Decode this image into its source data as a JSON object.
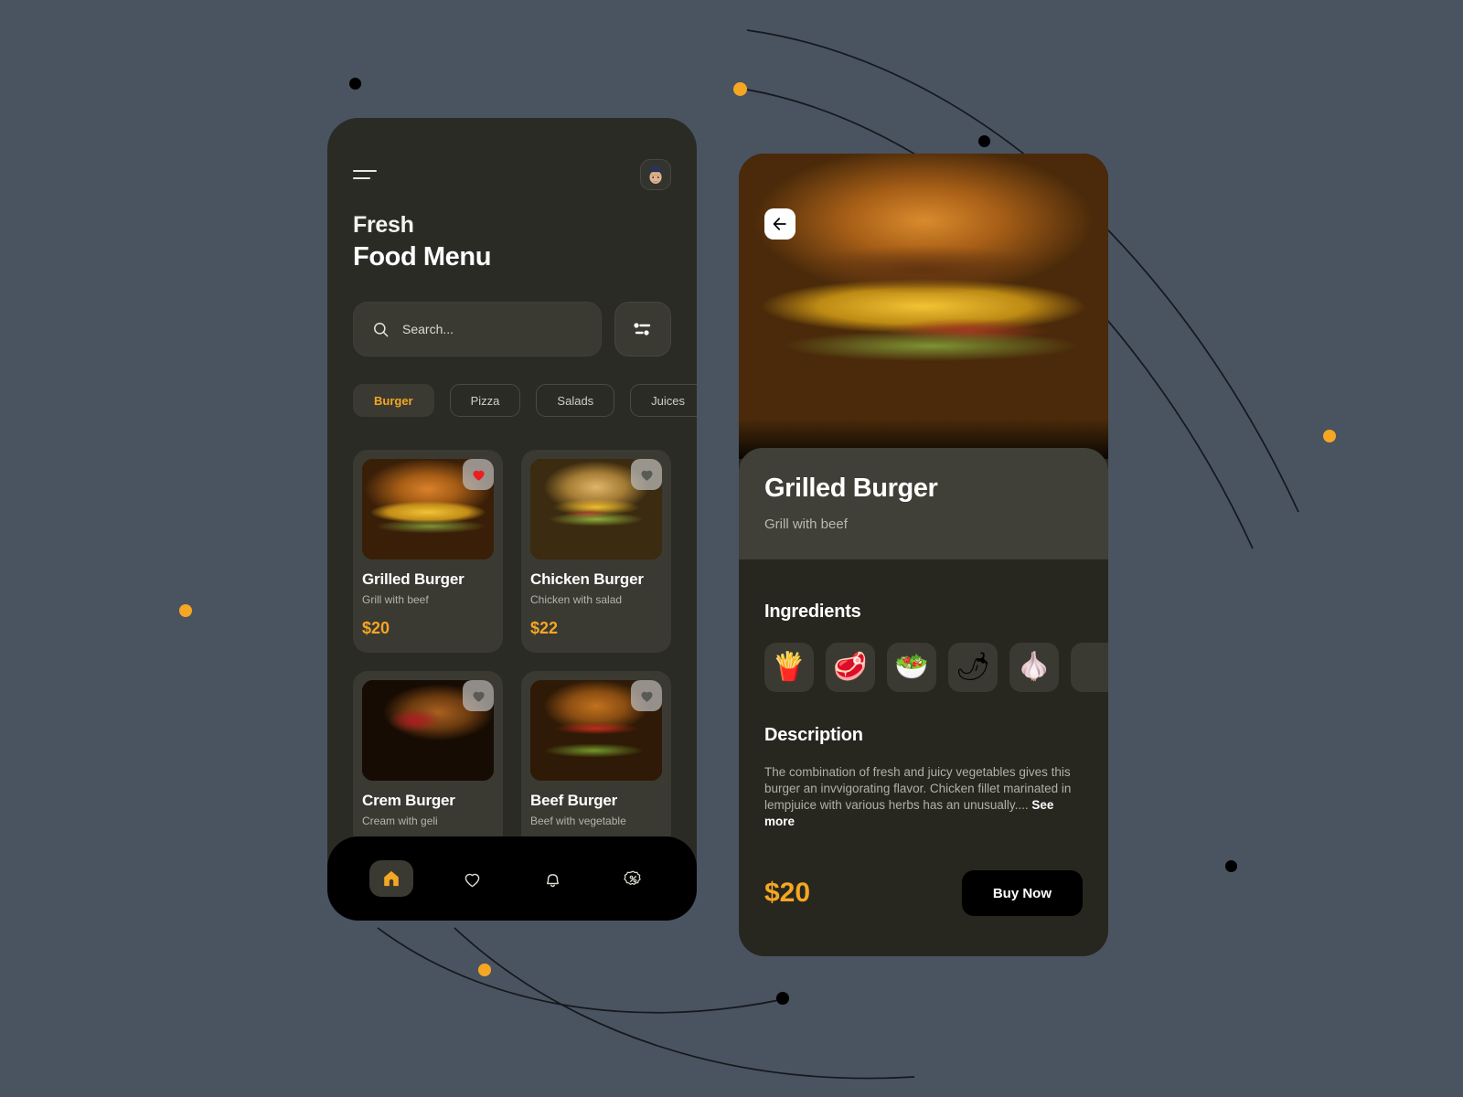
{
  "theme": {
    "page_background": "#4a5360",
    "panel_background": "#2b2b26",
    "card_background": "#3a3a33",
    "accent": "#f5a623",
    "text_primary": "#ffffff",
    "text_muted": "#b4b4ad",
    "nav_background": "#000000"
  },
  "menu_screen": {
    "menu_icon": "hamburger-icon",
    "avatar_icon": "user-avatar",
    "greeting_line1": "Fresh",
    "greeting_line2": "Food Menu",
    "search": {
      "icon": "search-icon",
      "value": "",
      "placeholder": "Search..."
    },
    "filter_icon": "filter-sliders-icon",
    "categories": [
      {
        "label": "Burger",
        "active": true
      },
      {
        "label": "Pizza",
        "active": false
      },
      {
        "label": "Salads",
        "active": false
      },
      {
        "label": "Juices",
        "active": false
      },
      {
        "label": "",
        "active": false
      }
    ],
    "items": [
      {
        "name": "Grilled Burger",
        "desc": "Grill with beef",
        "price": "$20",
        "favorite": true,
        "fav_icon": "heart-filled-icon"
      },
      {
        "name": "Chicken Burger",
        "desc": "Chicken with salad",
        "price": "$22",
        "favorite": false,
        "fav_icon": "heart-outline-icon"
      },
      {
        "name": "Crem Burger",
        "desc": "Cream with geli",
        "price": "",
        "favorite": false,
        "fav_icon": "heart-outline-icon"
      },
      {
        "name": "Beef Burger",
        "desc": "Beef with vegetable",
        "price": "",
        "favorite": false,
        "fav_icon": "heart-outline-icon"
      }
    ],
    "bottom_nav": [
      {
        "icon": "home-icon",
        "active": true
      },
      {
        "icon": "heart-icon",
        "active": false
      },
      {
        "icon": "bell-icon",
        "active": false
      },
      {
        "icon": "discount-badge-icon",
        "active": false
      }
    ]
  },
  "detail_screen": {
    "back_icon": "arrow-left-icon",
    "hero_image": "grilled-burger-photo",
    "title": "Grilled Burger",
    "subtitle": "Grill with beef",
    "ingredients_heading": "Ingredients",
    "ingredients": [
      {
        "name": "fries-icon",
        "glyph": "🍟"
      },
      {
        "name": "raw-meat-icon",
        "glyph": "🥩"
      },
      {
        "name": "salad-bowl-icon",
        "glyph": "🥗"
      },
      {
        "name": "bell-pepper-icon",
        "glyph": "🌶"
      },
      {
        "name": "onion-garlic-icon",
        "glyph": "🧄"
      },
      {
        "name": "more-ingredient-icon",
        "glyph": ""
      }
    ],
    "description_heading": "Description",
    "description_body": "The combination of fresh and juicy vegetables gives this burger an invvigorating flavor. Chicken fillet marinated in lempjuice with various herbs has an unusually....",
    "see_more_label": "See more",
    "price": "$20",
    "buy_label": "Buy Now"
  }
}
